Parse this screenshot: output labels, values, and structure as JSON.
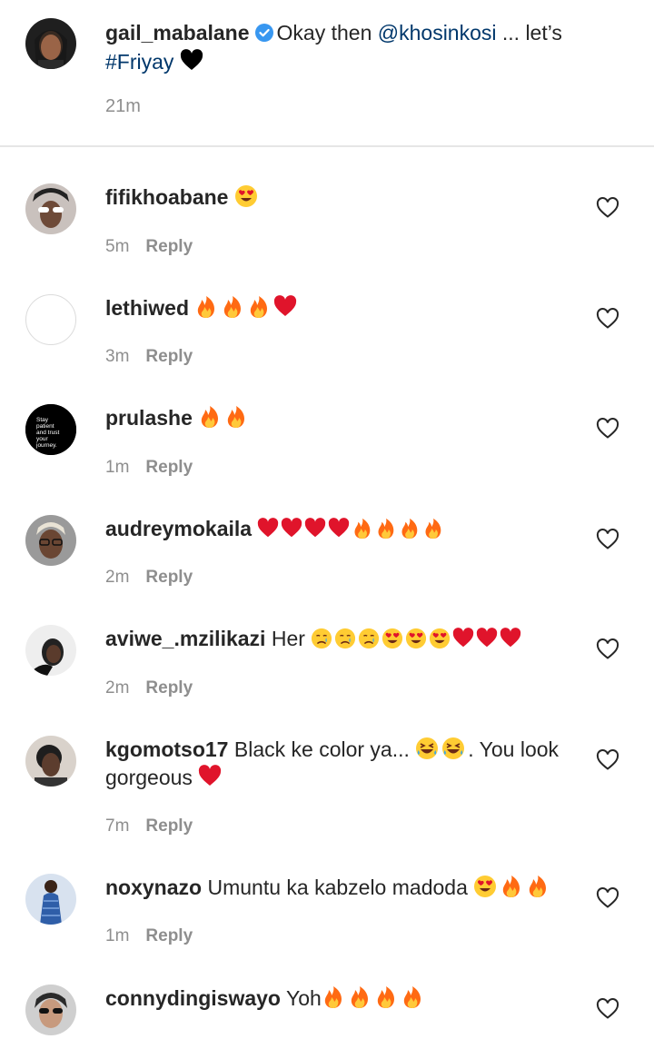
{
  "caption": {
    "username": "gail_mabalane",
    "text_before": "Okay then ",
    "mention": "@khosinkosi",
    "text_after": " ... let’s ",
    "hashtag": "#Friyay",
    "emoji": "black-heart",
    "time": "21m"
  },
  "comments": [
    {
      "username": "fifikhoabane",
      "text": "",
      "emojis": [
        "heart-eyes"
      ],
      "time": "5m",
      "reply": "Reply",
      "avatar_color": "#9c8f8a"
    },
    {
      "username": "lethiwed",
      "text": "",
      "emojis": [
        "fire",
        "fire",
        "fire",
        "red-heart"
      ],
      "time": "3m",
      "reply": "Reply",
      "avatar_color": "#ffffff"
    },
    {
      "username": "prulashe",
      "text": "",
      "emojis": [
        "fire",
        "fire"
      ],
      "time": "1m",
      "reply": "Reply",
      "avatar_color": "#000000",
      "avatar_text": "Stay patient and trust your journey."
    },
    {
      "username": "audreymokaila",
      "text": "",
      "emojis": [
        "red-heart",
        "red-heart",
        "red-heart",
        "red-heart",
        "fire",
        "fire",
        "fire",
        "fire"
      ],
      "time": "2m",
      "reply": "Reply",
      "avatar_color": "#8a8a8a"
    },
    {
      "username": "aviwe_.mzilikazi",
      "text": "Her ",
      "emojis": [
        "crying-face",
        "crying-face",
        "crying-face",
        "heart-eyes",
        "heart-eyes",
        "heart-eyes",
        "red-heart",
        "red-heart",
        "red-heart"
      ],
      "time": "2m",
      "reply": "Reply",
      "avatar_color": "#e8e8e8"
    },
    {
      "username": "kgomotso17",
      "text": "Black ke color ya... ",
      "emojis_mid": [
        "laughing",
        "laughing"
      ],
      "text_after": ". You look gorgeous ",
      "emojis": [
        "red-heart"
      ],
      "time": "7m",
      "reply": "Reply",
      "avatar_color": "#b7aba3"
    },
    {
      "username": "noxynazo",
      "text": "Umuntu ka kabzelo madoda ",
      "emojis": [
        "heart-eyes",
        "fire",
        "fire"
      ],
      "time": "1m",
      "reply": "Reply",
      "avatar_color": "#4a6ea8"
    },
    {
      "username": "connydingiswayo",
      "text": "Yoh",
      "emojis": [
        "fire",
        "fire",
        "fire",
        "fire"
      ],
      "time": "",
      "reply": "",
      "avatar_color": "#6b6b6b"
    }
  ],
  "colors": {
    "text": "#262626",
    "muted": "#8e8e8e",
    "link": "#00376b",
    "verified": "#3897f0",
    "divider": "#e6e6e6"
  }
}
